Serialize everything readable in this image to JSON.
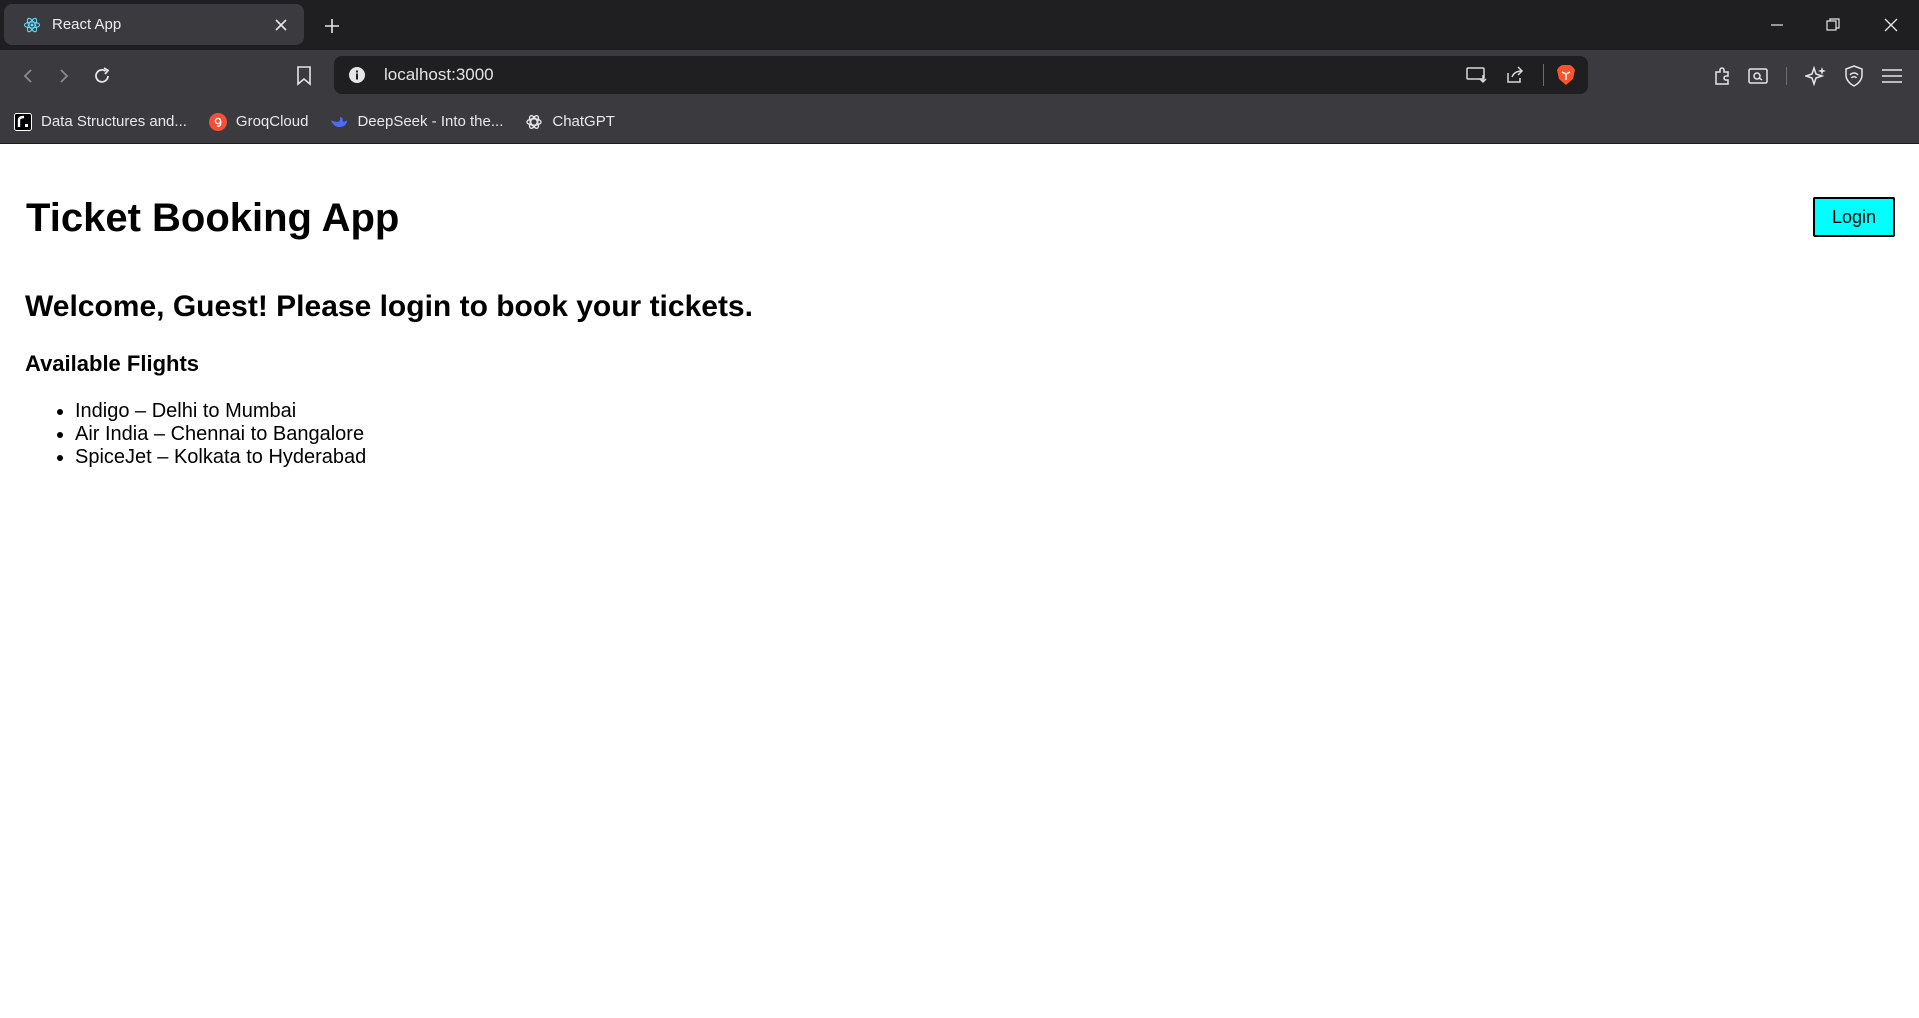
{
  "browser": {
    "tab": {
      "title": "React App",
      "favicon": "react-atom-icon"
    },
    "address_bar": {
      "url": "localhost:3000"
    },
    "bookmarks": [
      {
        "label": "Data Structures and...",
        "icon": "r-logo-icon"
      },
      {
        "label": "GroqCloud",
        "icon": "groq-logo-icon"
      },
      {
        "label": "DeepSeek - Into the...",
        "icon": "deepseek-logo-icon"
      },
      {
        "label": "ChatGPT",
        "icon": "openai-logo-icon"
      }
    ]
  },
  "app": {
    "title": "Ticket Booking App",
    "login_label": "Login",
    "welcome": "Welcome, Guest! Please login to book your tickets.",
    "flights_heading": "Available Flights",
    "flights": [
      "Indigo – Delhi to Mumbai",
      "Air India – Chennai to Bangalore",
      "SpiceJet – Kolkata to Hyderabad"
    ]
  },
  "colors": {
    "login_button_bg": "#00ffff",
    "browser_chrome": "#3b3b3f",
    "tab_strip": "#1f1f21"
  }
}
